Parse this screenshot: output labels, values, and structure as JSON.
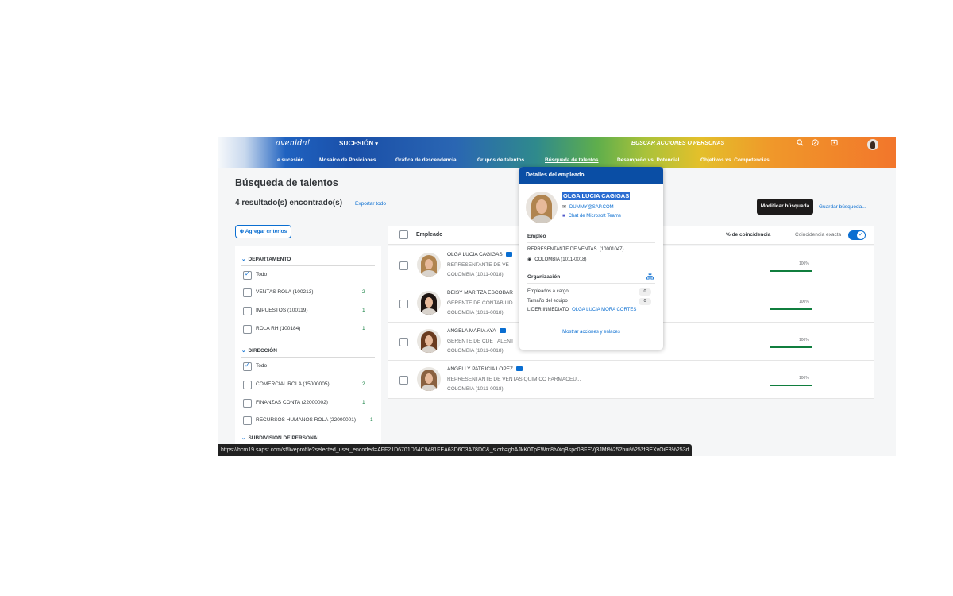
{
  "header": {
    "brand": "avenida!",
    "module": "SUCESIÓN",
    "module_caret": "▾",
    "search_placeholder": "BUSCAR ACCIONES O PERSONAS",
    "icons": [
      "search-icon",
      "help-icon",
      "notifications-icon"
    ]
  },
  "tabs": [
    {
      "label": "e sucesión"
    },
    {
      "label": "Mosaico de Posiciones"
    },
    {
      "label": "Gráfica de descendencia"
    },
    {
      "label": "Grupos de talentos"
    },
    {
      "label": "Búsqueda de talentos",
      "active": true
    },
    {
      "label": "Desempeño vs. Potencial"
    },
    {
      "label": "Objetivos vs. Competencias"
    }
  ],
  "page": {
    "title": "Búsqueda de talentos",
    "results": "4 resultado(s) encontrado(s)",
    "export": "Exportar todo",
    "modify_button": "Modificar búsqueda",
    "save_search": "Guardar búsqueda...",
    "add_criteria": "⊕ Agregar criterios"
  },
  "filters": {
    "departamento": {
      "title": "DEPARTAMENTO",
      "items": [
        {
          "label": "Todo",
          "checked": true,
          "count": ""
        },
        {
          "label": "VENTAS ROLA (100213)",
          "checked": false,
          "count": "2"
        },
        {
          "label": "IMPUESTOS (100119)",
          "checked": false,
          "count": "1"
        },
        {
          "label": "ROLA RH (100184)",
          "checked": false,
          "count": "1"
        }
      ]
    },
    "direccion": {
      "title": "DIRECCIÓN",
      "items": [
        {
          "label": "Todo",
          "checked": true,
          "count": ""
        },
        {
          "label": "COMERCIAL ROLA (15000005)",
          "checked": false,
          "count": "2"
        },
        {
          "label": "FINANZAS CONTA (22000002)",
          "checked": false,
          "count": "1"
        },
        {
          "label": "RECURSOS HUMANOS ROLA (22000001)",
          "checked": false,
          "count": "1"
        }
      ]
    },
    "subdivision_title": "SUBDIVISIÓN DE PERSONAL",
    "chevron": "⌄"
  },
  "table": {
    "col_employee": "Empleado",
    "col_match": "% de coincidencia",
    "col_exact": "Coincidencia exacta",
    "exact_on": true,
    "rows": [
      {
        "name": "OLGA LUCIA CAGIGAS",
        "title": "REPRESENTANTE DE VE",
        "location": "COLOMBIA (1011-0018)",
        "pct": "100%",
        "match": 1.0,
        "hair": "#b0844f"
      },
      {
        "name": "DEISY MARITZA ESCOBAR",
        "title": "GERENTE DE CONTABILID",
        "location": "COLOMBIA (1011-0018)",
        "pct": "100%",
        "match": 1.0,
        "hair": "#1e1512"
      },
      {
        "name": "ANGELA MARIA AYA",
        "title": "GERENTE DE CDE TALENT",
        "location": "COLOMBIA (1011-0018)",
        "pct": "100%",
        "match": 1.0,
        "hair": "#6a3b1f"
      },
      {
        "name": "ANGELLY PATRICIA LOPEZ",
        "title": "REPRESENTANTE DE VENTAS QUIMICO FARMACEU...",
        "location": "COLOMBIA (1011-0018)",
        "pct": "100%",
        "match": 1.0,
        "hair": "#8a6140"
      }
    ]
  },
  "popover": {
    "header": "Detalles del empleado",
    "name": "OLGA LUCIA CAGIGAS",
    "email": "DUMMY@SAP.COM",
    "teams": "Chat de Microsoft Teams",
    "empleo_title": "Empleo",
    "job": "REPRESENTANTE DE VENTAS. (10001047)",
    "location": "COLOMBIA (1011-0018)",
    "org_title": "Organización",
    "direct_reports_label": "Empleados a cargo",
    "direct_reports": "0",
    "team_size_label": "Tamaño del equipo",
    "team_size": "0",
    "manager_label": "LIDER INMEDIATO",
    "manager": "OLGA LUCIA MORA CORTES",
    "footer": "Mostrar acciones y enlaces"
  },
  "statusbar": {
    "url": "https://hcm19.sapsf.com/sf/liveprofile?selected_user_encoded=AFF21D6701D64C9481FEA63D6C3A78DC&_s.crb=ghAJkK0TpEWm8fvXqBspc0BFEVj3JMt%252bui%252fBEXvOiE8%253d"
  }
}
